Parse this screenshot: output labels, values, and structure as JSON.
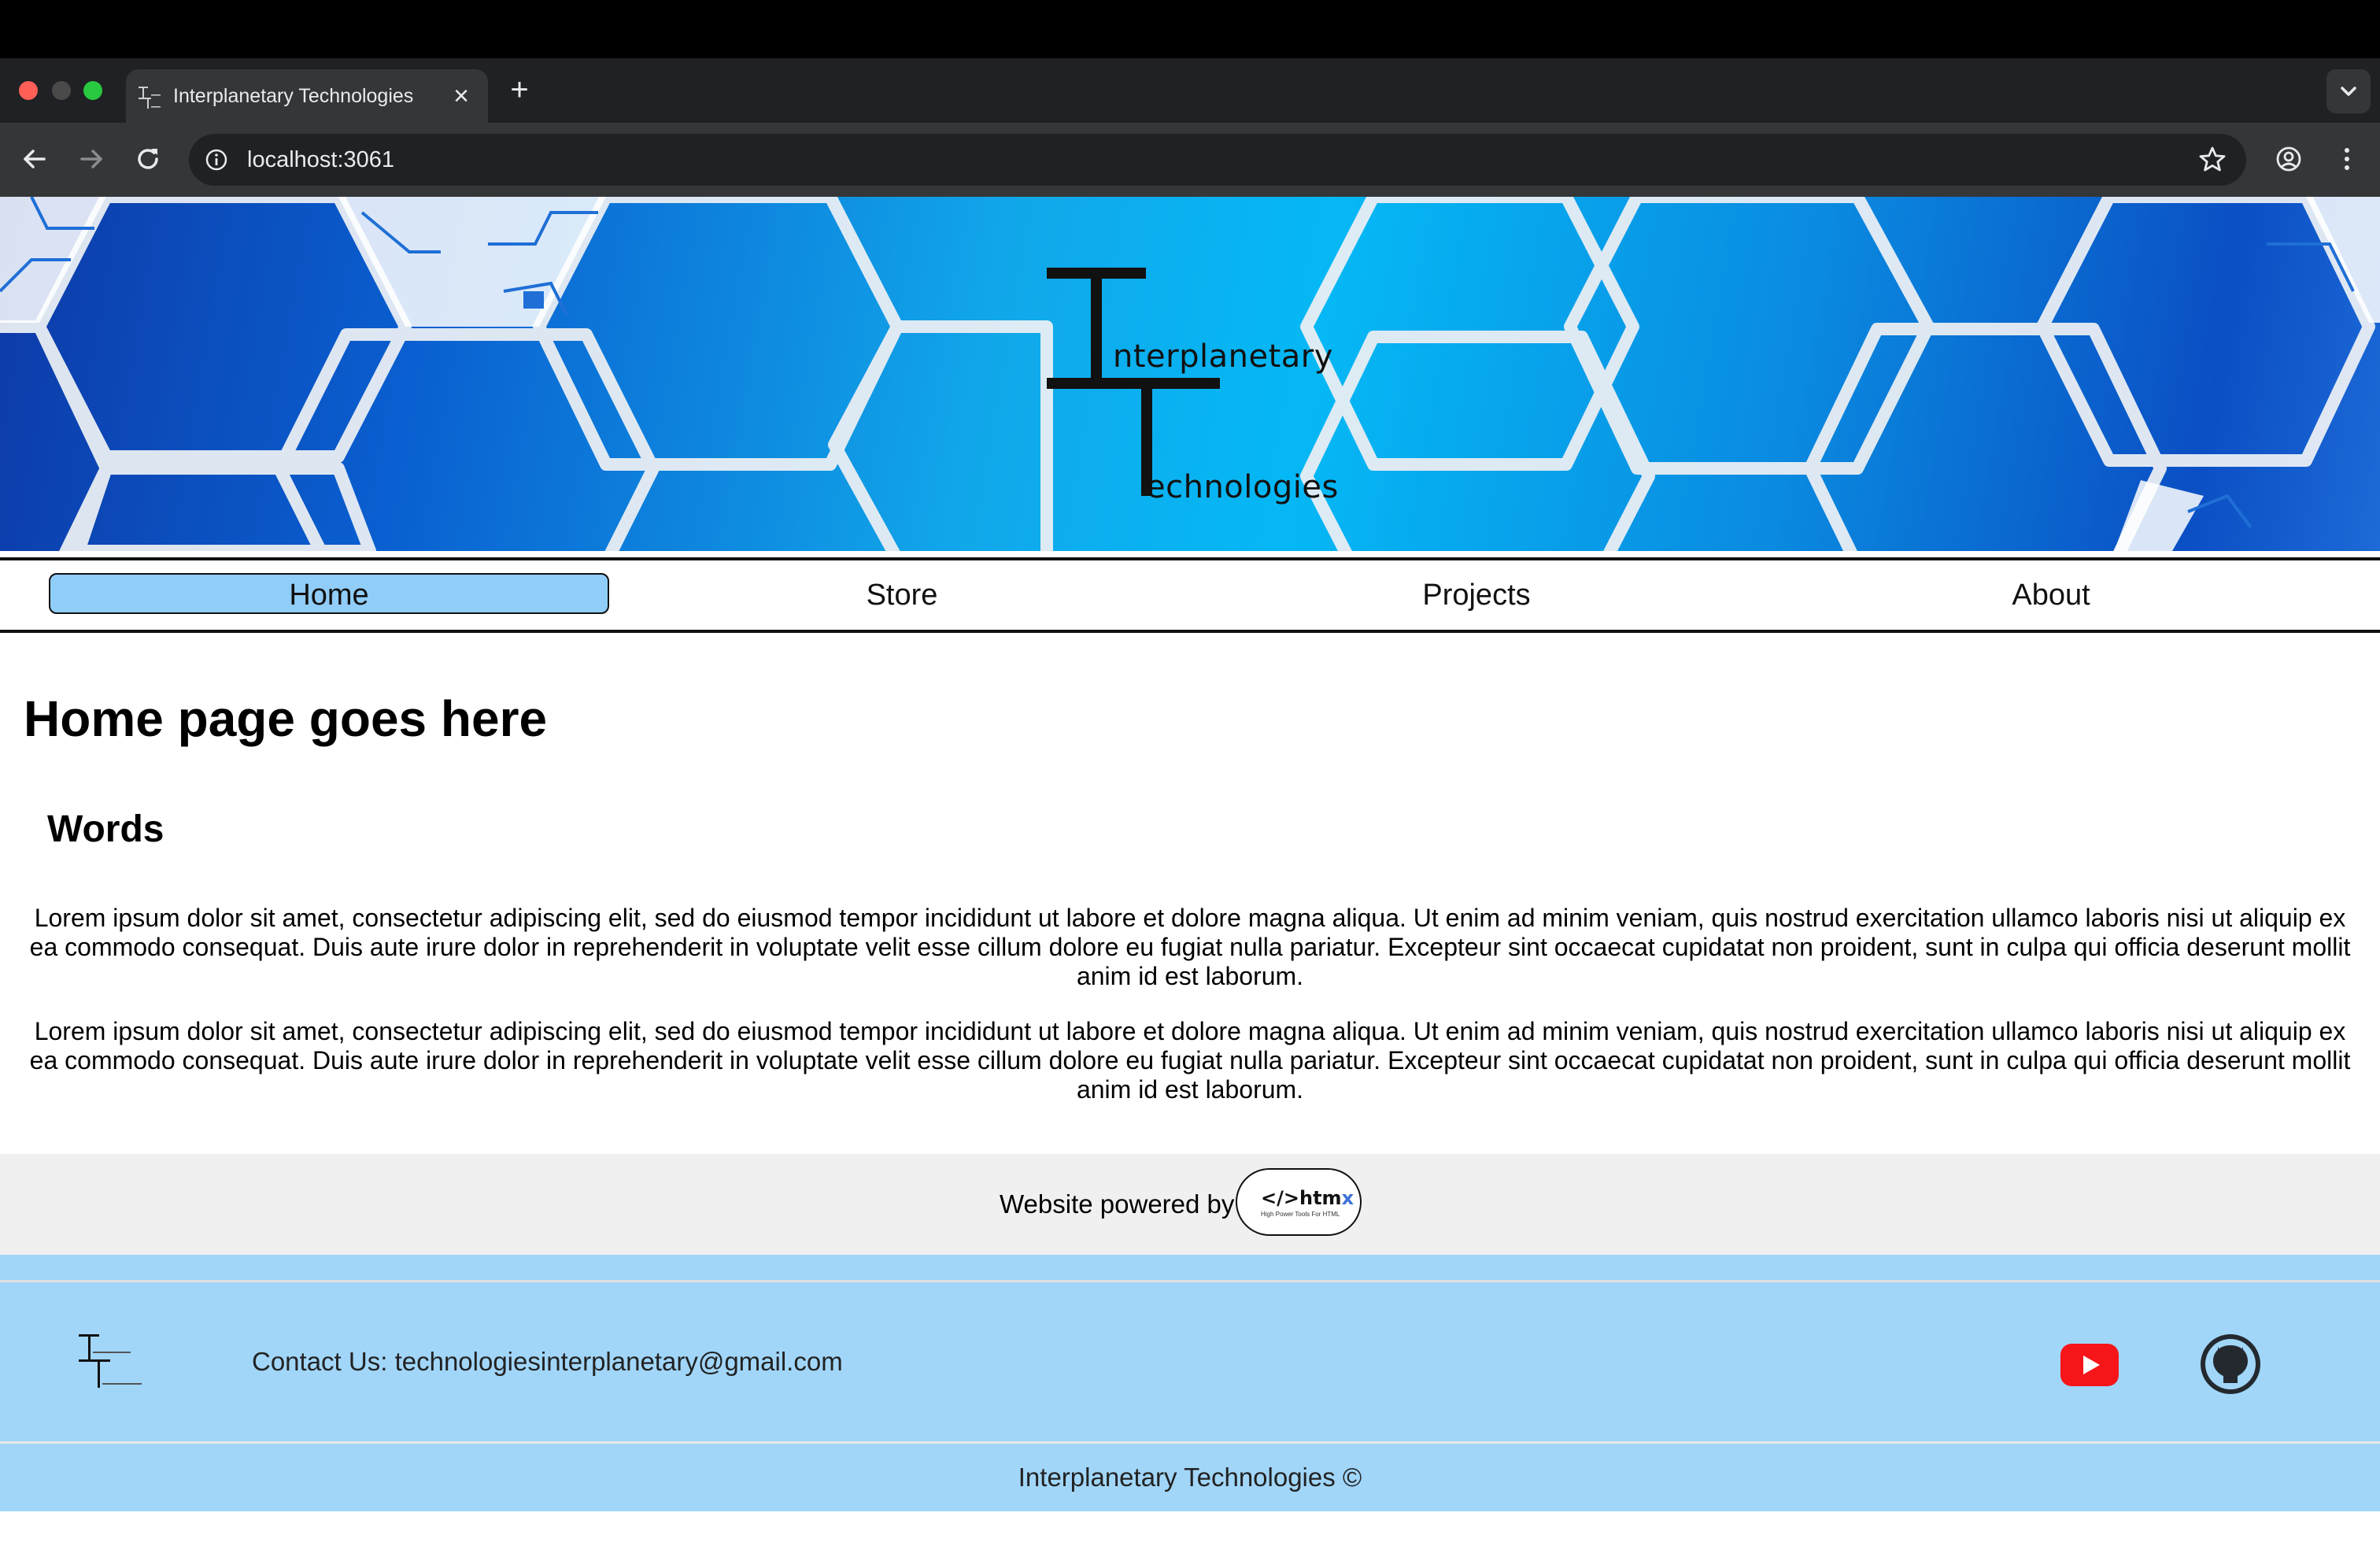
{
  "browser": {
    "tab_title": "Interplanetary Technologies",
    "url": "localhost:3061",
    "tab_close_glyph": "×",
    "new_tab_glyph": "+"
  },
  "site": {
    "logo": {
      "line1": "nterplanetary",
      "line2": "echnologies"
    },
    "nav": [
      {
        "label": "Home",
        "active": true
      },
      {
        "label": "Store",
        "active": false
      },
      {
        "label": "Projects",
        "active": false
      },
      {
        "label": "About",
        "active": false
      }
    ],
    "heading": "Home page goes here",
    "subheading": "Words",
    "paragraphs": [
      "Lorem ipsum dolor sit amet, consectetur adipiscing elit, sed do eiusmod tempor incididunt ut labore et dolore magna aliqua. Ut enim ad minim veniam, quis nostrud exercitation ullamco laboris nisi ut aliquip ex ea commodo consequat. Duis aute irure dolor in reprehenderit in voluptate velit esse cillum dolore eu fugiat nulla pariatur. Excepteur sint occaecat cupidatat non proident, sunt in culpa qui officia deserunt mollit anim id est laborum.",
      "Lorem ipsum dolor sit amet, consectetur adipiscing elit, sed do eiusmod tempor incididunt ut labore et dolore magna aliqua. Ut enim ad minim veniam, quis nostrud exercitation ullamco laboris nisi ut aliquip ex ea commodo consequat. Duis aute irure dolor in reprehenderit in voluptate velit esse cillum dolore eu fugiat nulla pariatur. Excepteur sint occaecat cupidatat non proident, sunt in culpa qui officia deserunt mollit anim id est laborum."
    ],
    "powered_by": "Website powered by",
    "htmx_badge": {
      "main": "</>htm",
      "x": "x",
      "tagline": "High Power Tools For HTML"
    },
    "footer": {
      "contact": "Contact Us: technologiesinterplanetary@gmail.com",
      "copyright": "Interplanetary Technologies ©",
      "social_icons": [
        "youtube-icon",
        "github-icon"
      ]
    },
    "colors": {
      "nav_active": "#90cdf8",
      "footer_bg": "#a1d6f9",
      "powered_bg": "#f0f0f0"
    }
  }
}
